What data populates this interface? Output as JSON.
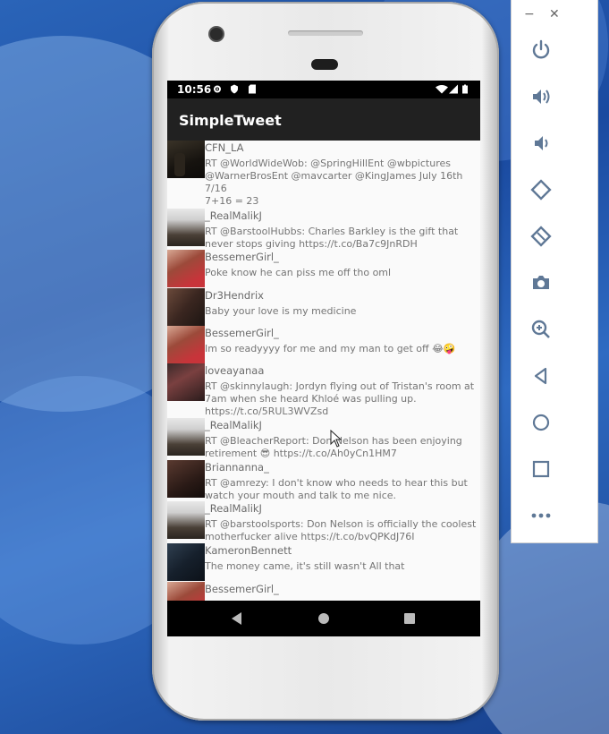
{
  "app": {
    "title": "SimpleTweet"
  },
  "status": {
    "time": "10:56"
  },
  "tweets": [
    {
      "user": "CFN_LA",
      "text": "RT @WorldWideWob: @SpringHillEnt @wbpictures @WarnerBrosEnt @mavcarter @KingJames July 16th\n7/16\n7+16 = 23"
    },
    {
      "user": "_RealMalikJ",
      "text": "RT @BarstoolHubbs: Charles Barkley is the gift that never stops giving https://t.co/Ba7c9JnRDH"
    },
    {
      "user": "BessemerGirl_",
      "text": "Poke know he can piss me off tho oml"
    },
    {
      "user": "Dr3Hendrix",
      "text": "Baby your love is my medicine"
    },
    {
      "user": "BessemerGirl_",
      "text": "Im so readyyyy for me and my man to get off 😂🤪"
    },
    {
      "user": "loveayanaa",
      "text": "RT @skinnylaugh: Jordyn flying out of Tristan's room at 7am when she heard Khloé was pulling up. https://t.co/5RUL3WVZsd"
    },
    {
      "user": "_RealMalikJ",
      "text": "RT @BleacherReport: Don Nelson has been enjoying retirement 😎 https://t.co/Ah0yCn1HM7"
    },
    {
      "user": "Briannanna_",
      "text": "RT @amrezy: I don't know who needs to hear this but watch your mouth and talk to me nice."
    },
    {
      "user": "_RealMalikJ",
      "text": "RT @barstoolsports: Don Nelson is officially the coolest motherfucker alive https://t.co/bvQPKdJ76I"
    },
    {
      "user": "KameronBennett",
      "text": "The money came, it's still wasn't All that"
    },
    {
      "user": "BessemerGirl_",
      "text": ""
    }
  ],
  "emulator": {
    "window_controls": {
      "minimize": "−",
      "close": "✕"
    },
    "buttons": [
      "power-icon",
      "volume-up-icon",
      "volume-down-icon",
      "rotate-left-icon",
      "rotate-right-icon",
      "camera-icon",
      "zoom-icon",
      "back-icon",
      "home-icon",
      "overview-icon",
      "more-icon"
    ]
  },
  "colors": {
    "appbar": "#212121",
    "statusbar": "#000000",
    "text": "#757575",
    "username": "#6b6b6b",
    "emulator_icons": "#5f7896"
  }
}
